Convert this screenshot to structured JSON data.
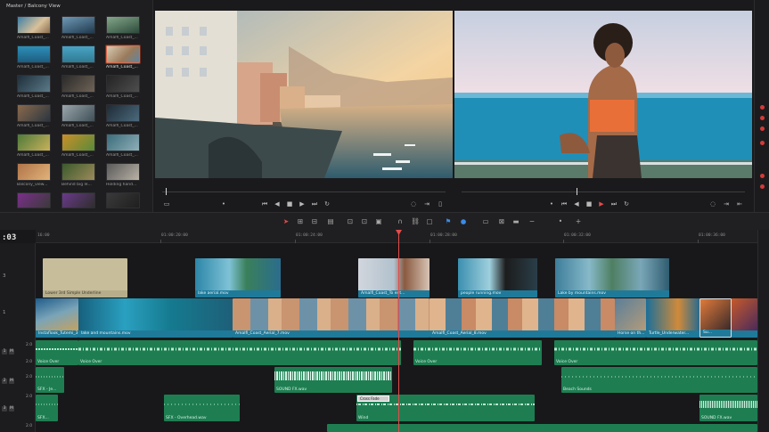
{
  "media_pool": {
    "breadcrumb": "Master / Balcony View",
    "clips": [
      [
        "Amalfi_Coast_...",
        "Amalfi_Coast_...",
        "Amalfi_Coast_..."
      ],
      [
        "Amalfi_Coast_...",
        "Amalfi_Coast_...",
        "Amalfi_Coast_..."
      ],
      [
        "Amalfi_Coast_...",
        "Amalfi_Coast_...",
        "Amalfi_Coast_..."
      ],
      [
        "Amalfi_Coast_...",
        "Amalfi_Coast_...",
        "Amalfi_Coast_..."
      ],
      [
        "Amalfi_Coast_...",
        "Amalfi_Coast_...",
        "Amalfi_Coast_..."
      ],
      [
        "Balcony_view...",
        "Behind big le...",
        "Holding hand..."
      ]
    ],
    "selected_clip": "Amalfi_Coast_..."
  },
  "timeline": {
    "timecode": ":03",
    "ruler": [
      "16:00",
      "01:00:20:00",
      "01:00:24:00",
      "01:00:28:00",
      "01:00:32:00",
      "01:00:36:00"
    ],
    "track_ids": [
      "3",
      "1",
      "1",
      "2",
      "3"
    ],
    "track_levels": [
      "2.0",
      "2.0",
      "2.0",
      "2.0",
      "2.0"
    ],
    "video_clips_v3": [
      "Lower 3rd Simple Underline",
      "lake aerial.mov",
      "Amalfi_Coast_To ent...",
      "people running.mov",
      "Lake by mountains.mov"
    ],
    "video_clips_v1": [
      "Instaflook_Tutemi_3...",
      "lake and mountains.mov",
      "Amalfi_Coast_Aerial_7.mov",
      "Amalfi_Coast_Aerial_8.mov",
      "Horse on th...",
      "Turtle_Underwater...",
      "Su..."
    ],
    "audio_clips_a1": [
      "Voice Over",
      "Voice Over",
      "Voice Over",
      "Voice Over"
    ],
    "audio_clips_a2": [
      "SFX - Je...",
      "SOUND FX.wav",
      "Beach Sounds"
    ],
    "audio_clips_a3": [
      "SFX...",
      "SFX - Overhead.wav",
      "Wind",
      "SOUND FX.wav"
    ],
    "cross_fade_label": "Cross Fade"
  },
  "colors": {
    "accent_red": "#e34b4b",
    "video_blue": "#1f7a9a",
    "audio_green": "#1e7e52",
    "select_orange": "#e0684a"
  },
  "icons": [
    "pointer-icon",
    "trim-icon",
    "blade-icon",
    "link-icon",
    "lock-icon",
    "flag-icon",
    "marker-icon",
    "snap-icon",
    "zoom-icon",
    "play-icon",
    "stop-icon",
    "loop-icon"
  ]
}
